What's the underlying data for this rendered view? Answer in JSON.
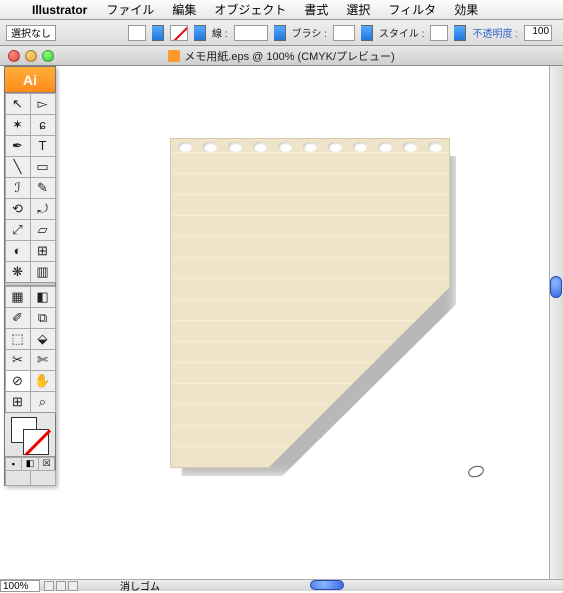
{
  "menubar": {
    "apple": "",
    "app_name": "Illustrator",
    "items": [
      "ファイル",
      "編集",
      "オブジェクト",
      "書式",
      "選択",
      "フィルタ",
      "効果"
    ]
  },
  "option_bar": {
    "selection": "選択なし",
    "stroke_label": "線 :",
    "brush_label": "ブラシ :",
    "style_label": "スタイル :",
    "opacity_label": "不透明度 :",
    "opacity_value": "100"
  },
  "titlebar": {
    "document": "メモ用紙.eps @ 100% (CMYK/プレビュー)"
  },
  "toolbox": {
    "logo": "Ai",
    "tools": [
      "⬚",
      "▭",
      "✒",
      "⌖",
      "T",
      "／",
      "▭",
      "✎",
      "⟲",
      "▱",
      "▱",
      "◧",
      "▤",
      "⧉",
      "◔",
      "⫴",
      "◩",
      "▦",
      "▤",
      "▢",
      "◧",
      "✂",
      "▤",
      "⊕",
      "⌖",
      "✋",
      "⌕",
      "⊘"
    ]
  },
  "status": {
    "zoom": "100%",
    "tool_name": "消しゴム"
  },
  "canvas": {
    "artwork": "memo-paper"
  }
}
